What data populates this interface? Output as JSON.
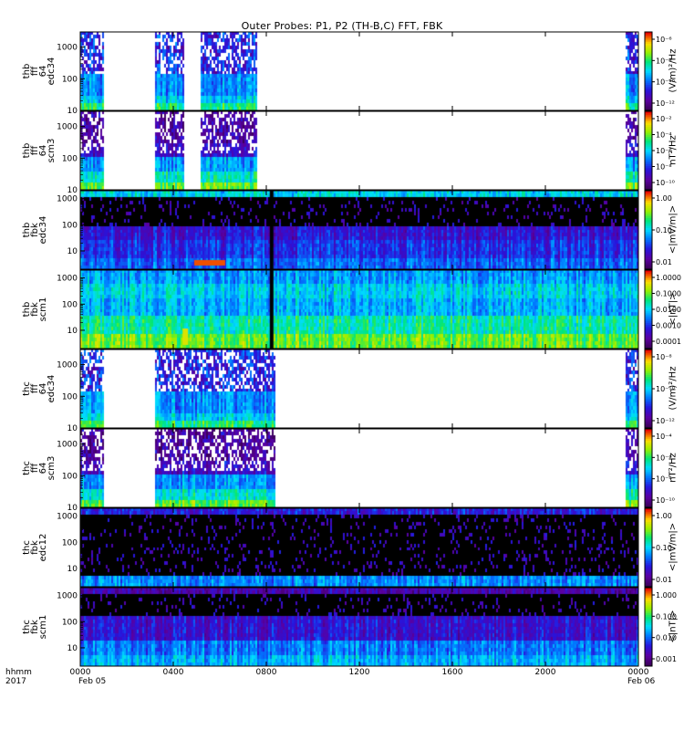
{
  "chart_data": {
    "type": "heatmap",
    "title": "Outer Probes: P1, P2 (TH-B,C) FFT, FBK",
    "x_axis": {
      "label_lines": [
        "hhmm",
        "2017"
      ],
      "ticks": [
        "0000",
        "0400",
        "0800",
        "1200",
        "1600",
        "2000",
        "0000"
      ],
      "tick_hours": [
        0,
        4,
        8,
        12,
        16,
        20,
        24
      ],
      "sub_labels": [
        "Feb 05",
        "Feb 06"
      ],
      "range_hours": [
        0,
        24
      ]
    },
    "colormap": "rainbow: purple-blue-cyan-green-yellow-red, black/white for low/no-data",
    "panels": [
      {
        "probe": "thb",
        "kind": "fft",
        "channel": "edc34",
        "ylabel": [
          "thb",
          "fff",
          "64",
          "edc34"
        ],
        "y_ticks": [
          "10",
          "100",
          "1000"
        ],
        "y_range_hz": [
          10,
          3000
        ],
        "y_log": true,
        "colorbar_label": "(V/m)²/Hz",
        "colorbar_ticks": [
          "10⁻⁶",
          "10⁻⁸",
          "10⁻¹⁰",
          "10⁻¹²"
        ],
        "data_intervals_hours": [
          [
            0.0,
            0.95
          ],
          [
            3.2,
            4.4
          ],
          [
            5.1,
            7.6
          ],
          [
            23.4,
            24.0
          ]
        ],
        "dominant": "blue/cyan base with sparse bursts to 2000 Hz"
      },
      {
        "probe": "thb",
        "kind": "fft",
        "channel": "scm3",
        "ylabel": [
          "thb",
          "fff",
          "64",
          "scm3"
        ],
        "y_ticks": [
          "10",
          "100",
          "1000"
        ],
        "y_range_hz": [
          10,
          3000
        ],
        "y_log": true,
        "colorbar_label": "nT²/Hz",
        "colorbar_ticks": [
          "10⁻²",
          "10⁻⁴",
          "10⁻⁶",
          "10⁻⁸",
          "10⁻¹⁰"
        ],
        "data_intervals_hours": [
          [
            0.0,
            0.95
          ],
          [
            3.2,
            4.4
          ],
          [
            5.1,
            7.6
          ],
          [
            23.4,
            24.0
          ]
        ],
        "dominant": "green/cyan at low freq, purple/white speckle at high freq"
      },
      {
        "probe": "thb",
        "kind": "fbk",
        "channel": "edc34",
        "ylabel": [
          "thb",
          "fbk",
          "edc34"
        ],
        "y_ticks": [
          "10",
          "100",
          "1000"
        ],
        "y_range_hz": [
          2,
          2000
        ],
        "y_log": true,
        "colorbar_label": "<|mV/m|>",
        "colorbar_ticks": [
          "1.00",
          "0.10",
          "0.01"
        ],
        "dominant": "black mid-band, cyan top band, blue/purple lower bands, red burst near 05:00"
      },
      {
        "probe": "thb",
        "kind": "fbk",
        "channel": "scm1",
        "ylabel": [
          "thb",
          "fbk",
          "scm1"
        ],
        "y_ticks": [
          "10",
          "100",
          "1000"
        ],
        "y_range_hz": [
          2,
          2000
        ],
        "y_log": true,
        "colorbar_label": "<|nT|>",
        "colorbar_ticks": [
          "1.0000",
          "0.1000",
          "0.0100",
          "0.0010",
          "0.0001"
        ],
        "dominant": "blue/cyan bands, green/yellow at lowest freq, black gap near 08:10"
      },
      {
        "probe": "thc",
        "kind": "fft",
        "channel": "edc34",
        "ylabel": [
          "thc",
          "fff",
          "64",
          "edc34"
        ],
        "y_ticks": [
          "10",
          "100",
          "1000"
        ],
        "y_range_hz": [
          10,
          3000
        ],
        "y_log": true,
        "colorbar_label": "(V/m)²/Hz",
        "colorbar_ticks": [
          "10⁻⁸",
          "10⁻¹⁰",
          "10⁻¹²"
        ],
        "data_intervals_hours": [
          [
            0.0,
            0.95
          ],
          [
            3.2,
            8.35
          ],
          [
            23.4,
            24.0
          ]
        ],
        "dominant": "blue/cyan base with sparse speckles"
      },
      {
        "probe": "thc",
        "kind": "fft",
        "channel": "scm3",
        "ylabel": [
          "thc",
          "fff",
          "64",
          "scm3"
        ],
        "y_ticks": [
          "10",
          "100",
          "1000"
        ],
        "y_range_hz": [
          10,
          3000
        ],
        "y_log": true,
        "colorbar_label": "nT²/Hz",
        "colorbar_ticks": [
          "10⁻⁴",
          "10⁻⁶",
          "10⁻⁸",
          "10⁻¹⁰"
        ],
        "data_intervals_hours": [
          [
            0.0,
            0.95
          ],
          [
            3.2,
            8.35
          ],
          [
            23.4,
            24.0
          ]
        ],
        "dominant": "green/cyan at low freq, purple/white at high freq"
      },
      {
        "probe": "thc",
        "kind": "fbk",
        "channel": "edc12",
        "ylabel": [
          "thc",
          "fbk",
          "edc12"
        ],
        "y_ticks": [
          "10",
          "100",
          "1000"
        ],
        "y_range_hz": [
          2,
          2000
        ],
        "y_log": true,
        "colorbar_label": "<|mV/m|>",
        "colorbar_ticks": [
          "1.00",
          "0.10",
          "0.01"
        ],
        "dominant": "black with purple streaks, blue/cyan lowest band"
      },
      {
        "probe": "thc",
        "kind": "fbk",
        "channel": "scm1",
        "ylabel": [
          "thc",
          "fbk",
          "scm1"
        ],
        "y_ticks": [
          "10",
          "100",
          "1000"
        ],
        "y_range_hz": [
          2,
          2000
        ],
        "y_log": true,
        "colorbar_label": "<|nT|>",
        "colorbar_ticks": [
          "1.000",
          "0.100",
          "0.010",
          "0.001"
        ],
        "dominant": "black top, blue/purple middle, cyan/blue bottom"
      }
    ]
  }
}
